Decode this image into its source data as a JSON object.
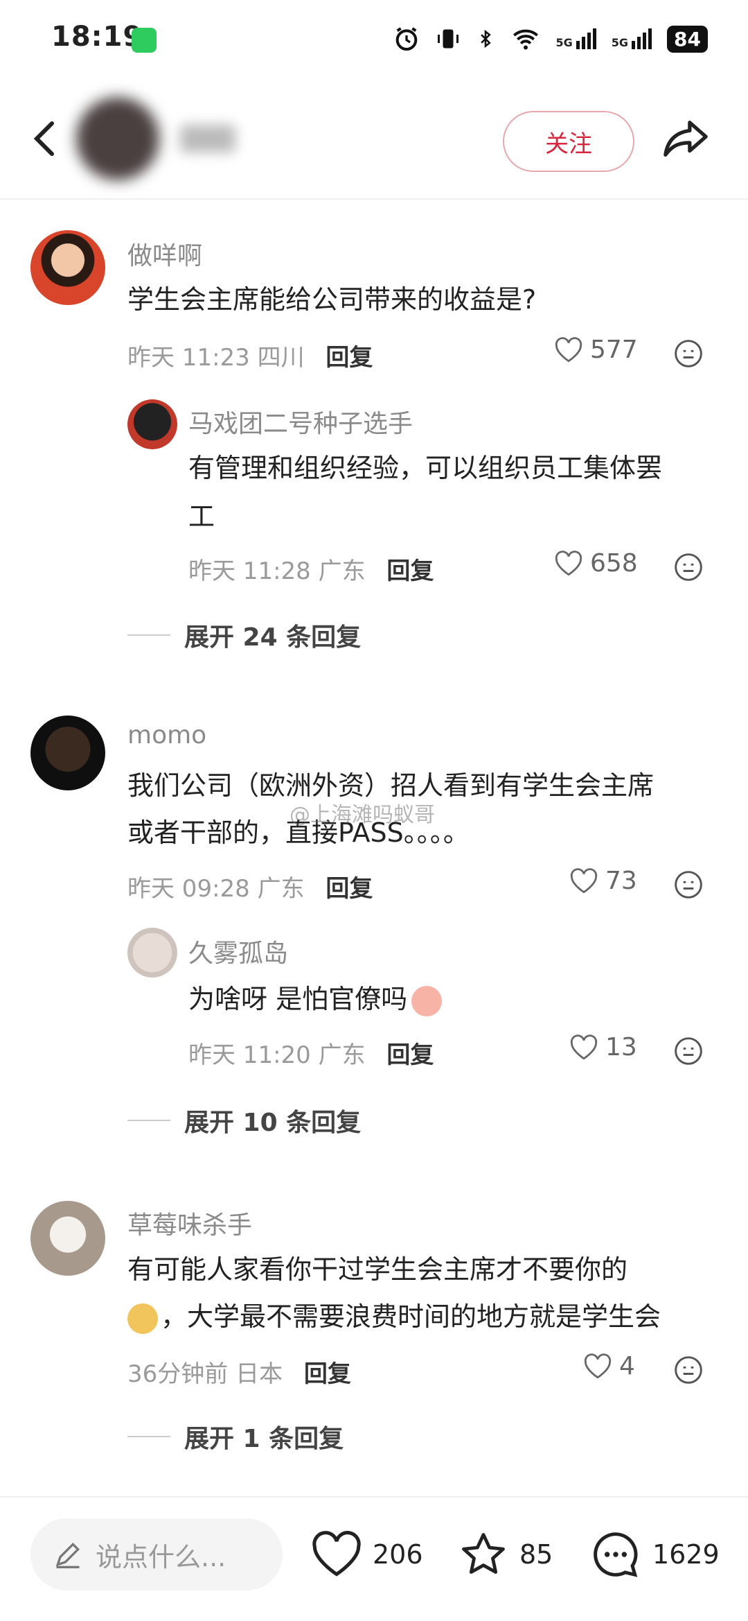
{
  "status_bar": {
    "time": "18:19",
    "battery": "84",
    "signal_label": "5G"
  },
  "header": {
    "follow_label": "关注"
  },
  "comments": [
    {
      "user": "做咩啊",
      "text": "学生会主席能给公司带来的收益是?",
      "time": "昨天 11:23",
      "location": "四川",
      "reply_label": "回复",
      "likes": "577",
      "replies": [
        {
          "user": "马戏团二号种子选手",
          "text_lines": [
            "有管理和组织经验，可以组织员工集体罢",
            "工"
          ],
          "time": "昨天 11:28",
          "location": "广东",
          "reply_label": "回复",
          "likes": "658"
        }
      ],
      "expand_label": "展开 24 条回复"
    },
    {
      "user": "momo",
      "text_lines": [
        "我们公司（欧洲外资）招人看到有学生会主席",
        "或者干部的，直接PASS。。。。"
      ],
      "time": "昨天 09:28",
      "location": "广东",
      "reply_label": "回复",
      "likes": "73",
      "replies": [
        {
          "user": "久雾孤岛",
          "text": "为啥呀 是怕官僚吗",
          "time": "昨天 11:20",
          "location": "广东",
          "reply_label": "回复",
          "likes": "13"
        }
      ],
      "expand_label": "展开 10 条回复"
    },
    {
      "user": "草莓味杀手",
      "text_lines": [
        "有可能人家看你干过学生会主席才不要你的",
        "，大学最不需要浪费时间的地方就是学生会"
      ],
      "time": "36分钟前",
      "location": "日本",
      "reply_label": "回复",
      "likes": "4",
      "expand_label": "展开 1 条回复"
    }
  ],
  "watermark": "@上海滩吗蚁哥",
  "bottom_bar": {
    "input_placeholder": "说点什么...",
    "likes": "206",
    "favorites": "85",
    "comments": "1629"
  },
  "colors": {
    "accent": "#d7263d",
    "follow_border": "#e6a7ad"
  }
}
